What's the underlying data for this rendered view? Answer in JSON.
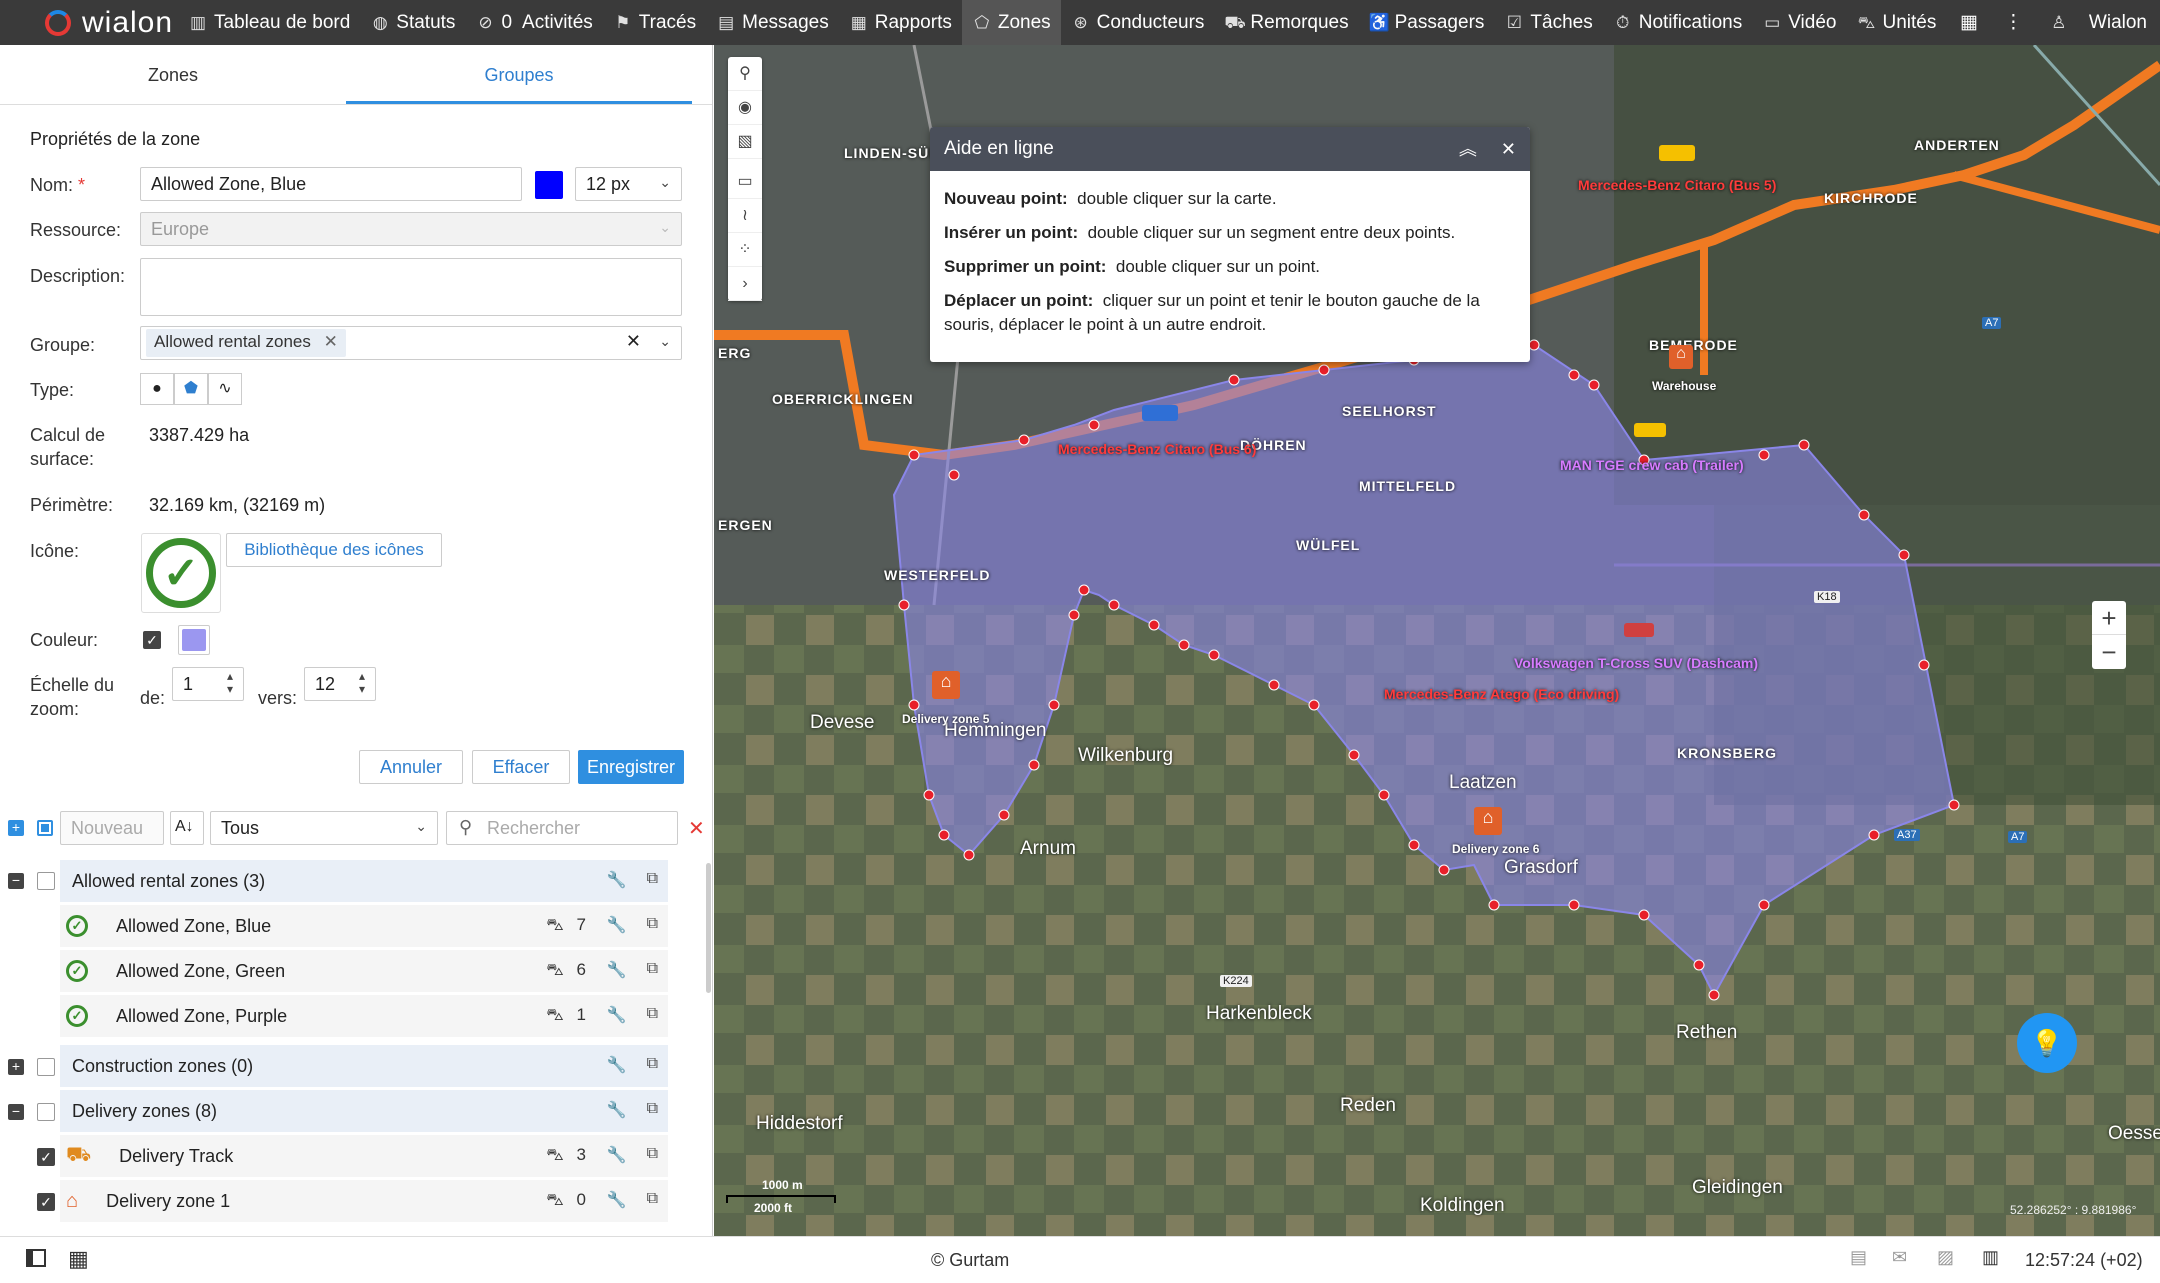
{
  "app": {
    "brand": "wialon"
  },
  "nav": {
    "items": [
      {
        "label": "Tableau de bord",
        "icon": "chart-icon"
      },
      {
        "label": "Statuts",
        "icon": "globe-icon"
      },
      {
        "label": "0",
        "icon": "check-circle-icon"
      },
      {
        "label": "Activités",
        "icon": ""
      },
      {
        "label": "Tracés",
        "icon": "flag-icon"
      },
      {
        "label": "Messages",
        "icon": "messages-icon"
      },
      {
        "label": "Rapports",
        "icon": "report-icon"
      },
      {
        "label": "Zones",
        "icon": "zones-icon"
      },
      {
        "label": "Conducteurs",
        "icon": "steering-icon"
      },
      {
        "label": "Remorques",
        "icon": "trailer-icon"
      },
      {
        "label": "Passagers",
        "icon": "passenger-icon"
      },
      {
        "label": "Tâches",
        "icon": "task-icon"
      },
      {
        "label": "Notifications",
        "icon": "bell-icon"
      },
      {
        "label": "Vidéo",
        "icon": "video-icon"
      },
      {
        "label": "Unités",
        "icon": "unit-icon"
      }
    ],
    "user": "Wialon"
  },
  "tabs": {
    "zones": "Zones",
    "groups": "Groupes"
  },
  "form": {
    "section_title": "Propriétés de la zone",
    "name_label": "Nom:",
    "name_required": "*",
    "name_value": "Allowed Zone, Blue",
    "name_color": "#0000ff",
    "font_size": "12 px",
    "resource_label": "Ressource:",
    "resource_value": "Europe",
    "description_label": "Description:",
    "description_value": "",
    "group_label": "Groupe:",
    "group_chip": "Allowed rental zones",
    "type_label": "Type:",
    "area_label_1": "Calcul de",
    "area_label_2": "surface:",
    "area_value": "3387.429 ha",
    "perimeter_label": "Périmètre:",
    "perimeter_value": "32.169 km, (32169 m)",
    "icon_label": "Icône:",
    "icon_library": "Bibliothèque des icônes",
    "color_label": "Couleur:",
    "zone_color": "#9b97f0",
    "zoom_label_1": "Échelle du",
    "zoom_label_2": "zoom:",
    "zoom_from_label": "de:",
    "zoom_from": "1",
    "zoom_to_label": "vers:",
    "zoom_to": "12",
    "cancel": "Annuler",
    "clear": "Effacer",
    "save": "Enregistrer"
  },
  "list_toolbar": {
    "new": "Nouveau",
    "sort": "A↓",
    "filter": "Tous",
    "search_placeholder": "Rechercher"
  },
  "list": {
    "groups": [
      {
        "name": "Allowed rental zones (3)",
        "expanded": true
      },
      {
        "name": "Construction zones (0)",
        "expanded": false
      },
      {
        "name": "Delivery zones (8)",
        "expanded": true
      }
    ],
    "items": [
      {
        "name": "Allowed Zone, Blue",
        "count": "7"
      },
      {
        "name": "Allowed Zone, Green",
        "count": "6"
      },
      {
        "name": "Allowed Zone, Purple",
        "count": "1"
      },
      {
        "name": "Delivery Track",
        "count": "3"
      },
      {
        "name": "Delivery zone 1",
        "count": "0"
      }
    ]
  },
  "help": {
    "title": "Aide en ligne",
    "rows": [
      {
        "key": "Nouveau point:",
        "text": "double cliquer sur la carte."
      },
      {
        "key": "Insérer un point:",
        "text": "double cliquer sur un segment entre deux points."
      },
      {
        "key": "Supprimer un point:",
        "text": "double cliquer sur un point."
      },
      {
        "key": "Déplacer un point:",
        "text": "cliquer sur un point et tenir le bouton gauche de la souris, déplacer le point à un autre endroit."
      }
    ]
  },
  "map": {
    "places": [
      "LINDEN-SÜD",
      "ANDERTEN",
      "KIRCHRODE",
      "BEMERODE",
      "SEELHORST",
      "DÖHREN",
      "MITTELFELD",
      "WÜLFEL",
      "OBERRICKLINGEN",
      "WESTERFELD",
      "KRONSBERG",
      "Laatzen",
      "Grasdorf",
      "Wilkenburg",
      "Hemmingen",
      "Arnum",
      "Devese",
      "Harkenbleck",
      "Rethen",
      "Reden",
      "Hiddestorf",
      "Gleidingen",
      "Koldingen",
      "Oessel",
      "ERG",
      "ERGEN"
    ],
    "units": [
      "Mercedes-Benz Citaro (Bus 5)",
      "Mercedes-Benz Citaro (Bus 6)",
      "MAN TGE crew cab (Trailer)",
      "Volkswagen T-Cross SUV (Dashcam)",
      "Mercedes-Benz Atego (Eco driving)"
    ],
    "markers": [
      "Warehouse",
      "Delivery zone 5",
      "Delivery zone 6"
    ],
    "scale_m": "1000 m",
    "scale_ft": "2000 ft",
    "coords": "52.286252° : 9.881986°"
  },
  "status": {
    "copyright": "© Gurtam",
    "time": "12:57:24 (+02)"
  },
  "colors": {
    "accent": "#2f8fe0",
    "zone_fill": "#8a86e8",
    "zone_border": "#e8202a",
    "route": "#f07a22"
  }
}
